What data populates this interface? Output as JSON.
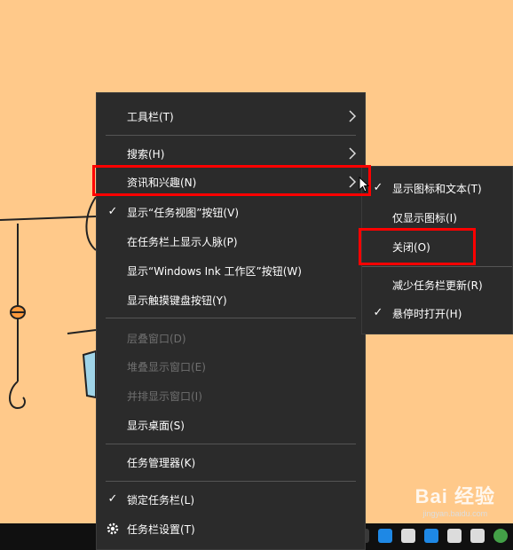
{
  "main_menu": {
    "items": [
      {
        "label": "工具栏(T)"
      },
      {
        "label": "搜索(H)"
      },
      {
        "label": "资讯和兴趣(N)"
      },
      {
        "label": "显示“任务视图”按钮(V)"
      },
      {
        "label": "在任务栏上显示人脉(P)"
      },
      {
        "label": "显示“Windows Ink 工作区”按钮(W)"
      },
      {
        "label": "显示触摸键盘按钮(Y)"
      },
      {
        "label": "层叠窗口(D)"
      },
      {
        "label": "堆叠显示窗口(E)"
      },
      {
        "label": "并排显示窗口(I)"
      },
      {
        "label": "显示桌面(S)"
      },
      {
        "label": "任务管理器(K)"
      },
      {
        "label": "锁定任务栏(L)"
      },
      {
        "label": "任务栏设置(T)"
      }
    ]
  },
  "sub_menu": {
    "items": [
      {
        "label": "显示图标和文本(T)"
      },
      {
        "label": "仅显示图标(I)"
      },
      {
        "label": "关闭(O)"
      },
      {
        "label": "减少任务栏更新(R)"
      },
      {
        "label": "悬停时打开(H)"
      }
    ]
  },
  "watermark": {
    "brand": "Bai 经验",
    "url": "jingyan.baidu.com"
  },
  "colors": {
    "menu_bg": "#2b2b2b",
    "highlight": "#ff0000",
    "desktop": "#FFC98A"
  }
}
